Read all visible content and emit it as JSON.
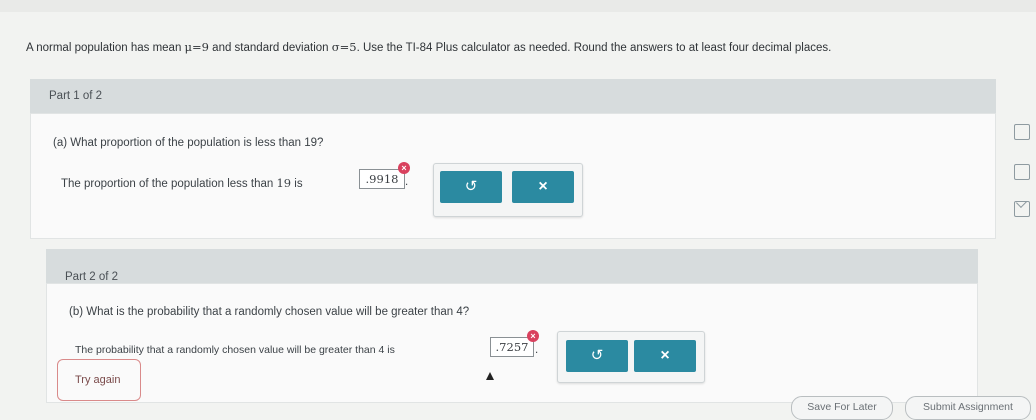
{
  "problem": {
    "prefix": "A normal population has mean ",
    "mean_expr": "μ=9",
    "middle": " and standard deviation ",
    "sd_expr": "σ=5",
    "suffix": ". Use the TI-84 Plus calculator as needed. Round the answers to at least four decimal places."
  },
  "part1": {
    "header": "Part 1 of 2",
    "question": "(a) What proportion of the population is less than 19?",
    "answer_prefix": "The proportion of the population less than ",
    "answer_value_label": "19",
    "answer_mid": " is ",
    "answer_value": ".9918",
    "answer_suffix": ".",
    "error_symbol": "×"
  },
  "part2": {
    "header": "Part 2 of 2",
    "question": "(b) What is the probability that a randomly chosen value will be greater than 4?",
    "answer_prefix": "The probability that a randomly chosen value will be greater than 4 is ",
    "answer_value": ".7257",
    "answer_suffix": ".",
    "error_symbol": "×"
  },
  "buttons": {
    "undo_symbol": "↺",
    "clear_symbol": "×",
    "try_again": "Try again",
    "save_for_later": "Save For Later",
    "submit": "Submit Assignment"
  },
  "colors": {
    "button": "#2b8aa1",
    "error": "#d9415e",
    "header_bg": "#d7dcdd"
  }
}
